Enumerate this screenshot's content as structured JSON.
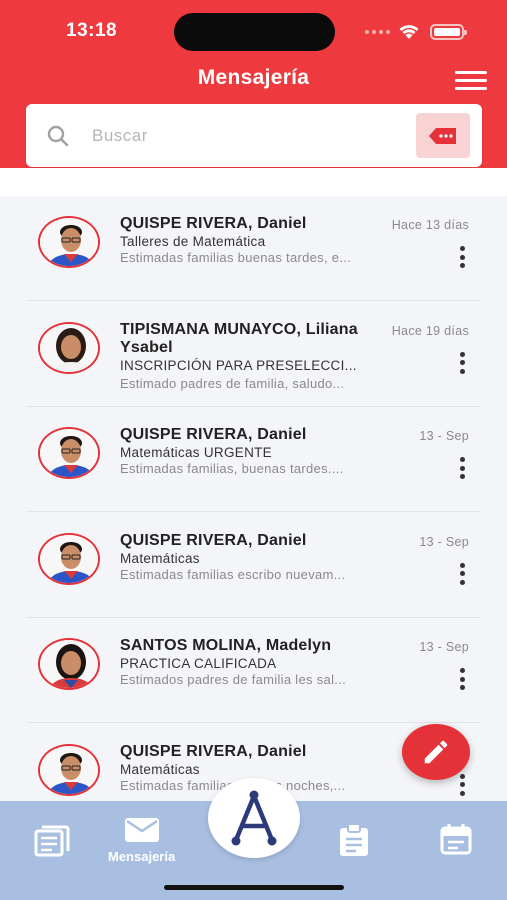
{
  "status": {
    "time": "13:18"
  },
  "header": {
    "title": "Mensajería"
  },
  "search": {
    "placeholder": "Buscar"
  },
  "messages": [
    {
      "name": "QUISPE RIVERA, Daniel",
      "subject": "Talleres de Matemática",
      "preview": "Estimadas familias buenas tardes, e...",
      "date": "Hace 13 días",
      "avatar": "male"
    },
    {
      "name": "TIPISMANA MUNAYCO, Liliana Ysabel",
      "subject": "INSCRIPCIÓN PARA PRESELECCI...",
      "preview": "Estimado padres de familia, saludo...",
      "date": "Hace 19 días",
      "avatar": "female-older"
    },
    {
      "name": "QUISPE RIVERA, Daniel",
      "subject": "Matemáticas URGENTE",
      "preview": "Estimadas familias, buenas tardes....",
      "date": "13 - Sep",
      "avatar": "male"
    },
    {
      "name": "QUISPE RIVERA, Daniel",
      "subject": "Matemáticas",
      "preview": "Estimadas familias escribo nuevam...",
      "date": "13 - Sep",
      "avatar": "male"
    },
    {
      "name": "SANTOS MOLINA, Madelyn",
      "subject": "PRACTICA CALIFICADA",
      "preview": "Estimados padres de familia les sal...",
      "date": "13 - Sep",
      "avatar": "female"
    },
    {
      "name": "QUISPE RIVERA, Daniel",
      "subject": "Matemáticas",
      "preview": "Estimadas familias buenas noches,...",
      "date": "13 - Sep",
      "avatar": "male"
    }
  ],
  "bottom_nav": {
    "messaging_label": "Mensajería"
  },
  "colors": {
    "brand_red": "#ee3a3f",
    "nav_blue": "#a9bfe2",
    "logo_navy": "#2c3a7a"
  },
  "icons": [
    "search-icon",
    "tag-icon",
    "menu-icon",
    "more-vert-icon",
    "edit-icon",
    "news-icon",
    "mail-icon",
    "assignment-icon",
    "calendar-icon"
  ]
}
